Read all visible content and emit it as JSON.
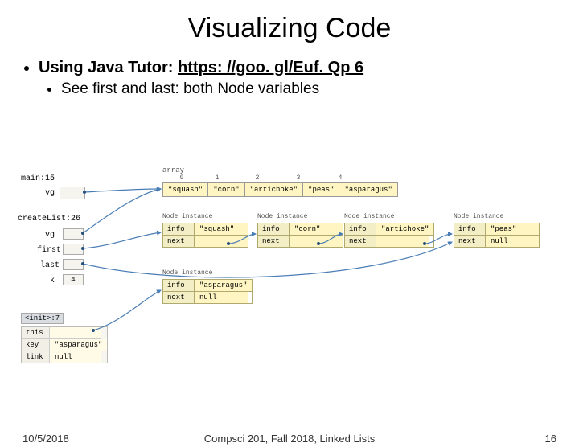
{
  "title": "Visualizing Code",
  "bullet1_label": "Using Java Tutor: ",
  "bullet1_link": "https: //goo. gl/Euf. Qp 6",
  "bullet2": "See first and last: both Node variables",
  "frames": {
    "main": "main:15",
    "create": "createList:26",
    "init": "<init>:7"
  },
  "vars": {
    "vg": "vg",
    "first": "first",
    "last": "last",
    "k": "k",
    "k_val": "4",
    "this": "this",
    "key": "key",
    "link": "link",
    "key_val": "\"asparagus\"",
    "link_val": "null"
  },
  "array_label": "array",
  "array_idx": [
    "0",
    "1",
    "2",
    "3",
    "4"
  ],
  "array": [
    "\"squash\"",
    "\"corn\"",
    "\"artichoke\"",
    "\"peas\"",
    "\"asparagus\""
  ],
  "node_label": "Node instance",
  "node_fields": {
    "info": "info",
    "next": "next"
  },
  "nodes": [
    {
      "info": "\"squash\"",
      "next": ""
    },
    {
      "info": "\"corn\"",
      "next": ""
    },
    {
      "info": "\"artichoke\"",
      "next": ""
    },
    {
      "info": "\"peas\"",
      "next": "null"
    }
  ],
  "node_bottom": {
    "info": "\"asparagus\"",
    "next": "null"
  },
  "footer": {
    "date": "10/5/2018",
    "center": "Compsci 201, Fall 2018, Linked Lists",
    "page": "16"
  }
}
